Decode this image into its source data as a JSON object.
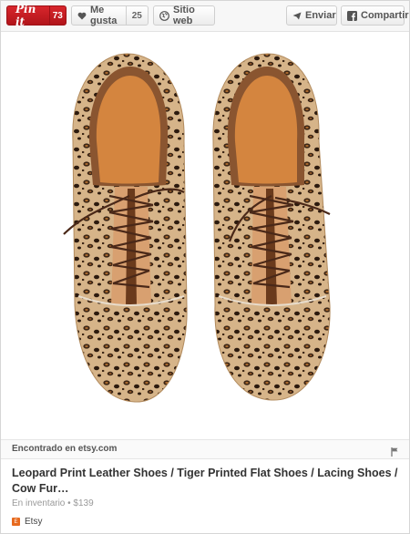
{
  "toolbar": {
    "pin_label": "Pin it",
    "pin_count": "73",
    "like_label": "Me gusta",
    "like_count": "25",
    "site_label": "Sitio web",
    "send_label": "Enviar",
    "share_label": "Compartir"
  },
  "found": {
    "text": "Encontrado en etsy.com"
  },
  "product": {
    "title": "Leopard Print Leather Shoes / Tiger Printed Flat Shoes / Lacing Shoes / Cow Fur…",
    "meta": "En inventario • $139",
    "source": "Etsy"
  },
  "icons": {
    "pin": "pinterest-logo",
    "like": "heart-icon",
    "site": "globe-icon",
    "send": "paper-plane-icon",
    "share": "facebook-icon",
    "flag": "flag-icon",
    "etsy": "etsy-logo"
  },
  "colors": {
    "pin_red": "#c8232c",
    "etsy_orange": "#e76a1e",
    "leather": "#c7976a",
    "lining": "#d88a4a",
    "laces": "#4a2818"
  }
}
